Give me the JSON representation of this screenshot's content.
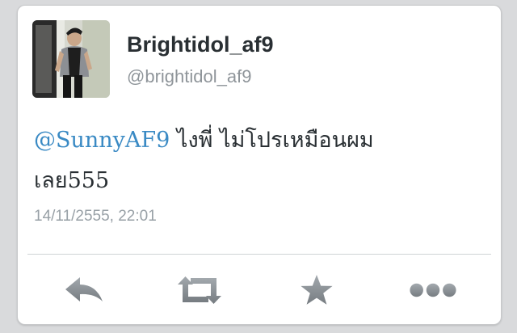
{
  "tweet": {
    "display_name": "Brightidol_af9",
    "screen_name": "@brightidol_af9",
    "mention": "@SunnyAF9",
    "text_line1": " ไงพี่ ไม่โปรเหมือนผม",
    "text_line2": "เลย555",
    "timestamp": "14/11/2555, 22:01"
  },
  "actions": {
    "reply_icon": "reply-icon",
    "retweet_icon": "retweet-icon",
    "favorite_icon": "star-icon",
    "more_icon": "more-dots-icon"
  },
  "colors": {
    "mention": "#3a8ac4",
    "icon": "#8a9095",
    "background": "#d9dadc"
  }
}
